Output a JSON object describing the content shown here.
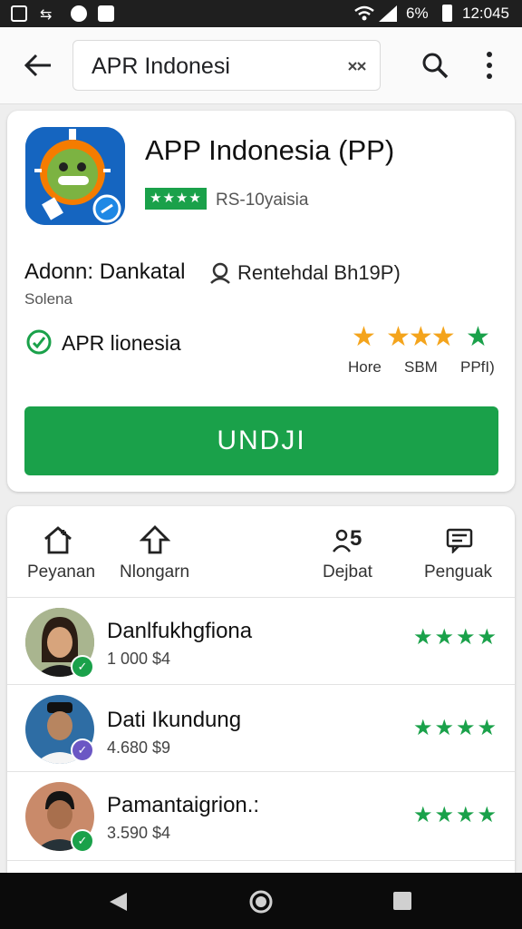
{
  "status_bar": {
    "battery": "6%",
    "time": "12:045"
  },
  "search": {
    "query": "APR Indonesi"
  },
  "app": {
    "title": "APP Indonesia (PP)",
    "rating_stars": "★★★★",
    "rating_text": "RS-10yaisia",
    "developer_label": "Adonn: Dankatal",
    "developer_sub": "Solena",
    "contact_label": "Rentehdal  Bh19P)",
    "brand_label": "APR lionesia",
    "mini_ratings": [
      {
        "label": "Hore",
        "color": "#f4a41c"
      },
      {
        "label": "SBM",
        "color": "#f4a41c"
      },
      {
        "label": "PPfI)",
        "color": "#1aa14a"
      }
    ],
    "install_label": "UNDJI"
  },
  "tabs": [
    {
      "label": "Peyanan",
      "icon": "home-icon"
    },
    {
      "label": "Nlongarn",
      "icon": "upload-icon"
    },
    {
      "label": "Dejbat",
      "icon": "people-count-icon",
      "value": "5"
    },
    {
      "label": "Penguak",
      "icon": "review-icon"
    }
  ],
  "reviewers": [
    {
      "name": "Danlfukhgfiona",
      "count": "1 000 $4",
      "stars": "★★★★"
    },
    {
      "name": "Dati Ikundung",
      "count": "4.680 $9",
      "stars": "★★★★"
    },
    {
      "name": "Pamantaigrion.:",
      "count": "3.590 $4",
      "stars": "★★★★"
    }
  ],
  "colors": {
    "accent": "#1aa14a",
    "star_gold": "#f4a41c",
    "icon_blue": "#1565c0"
  }
}
